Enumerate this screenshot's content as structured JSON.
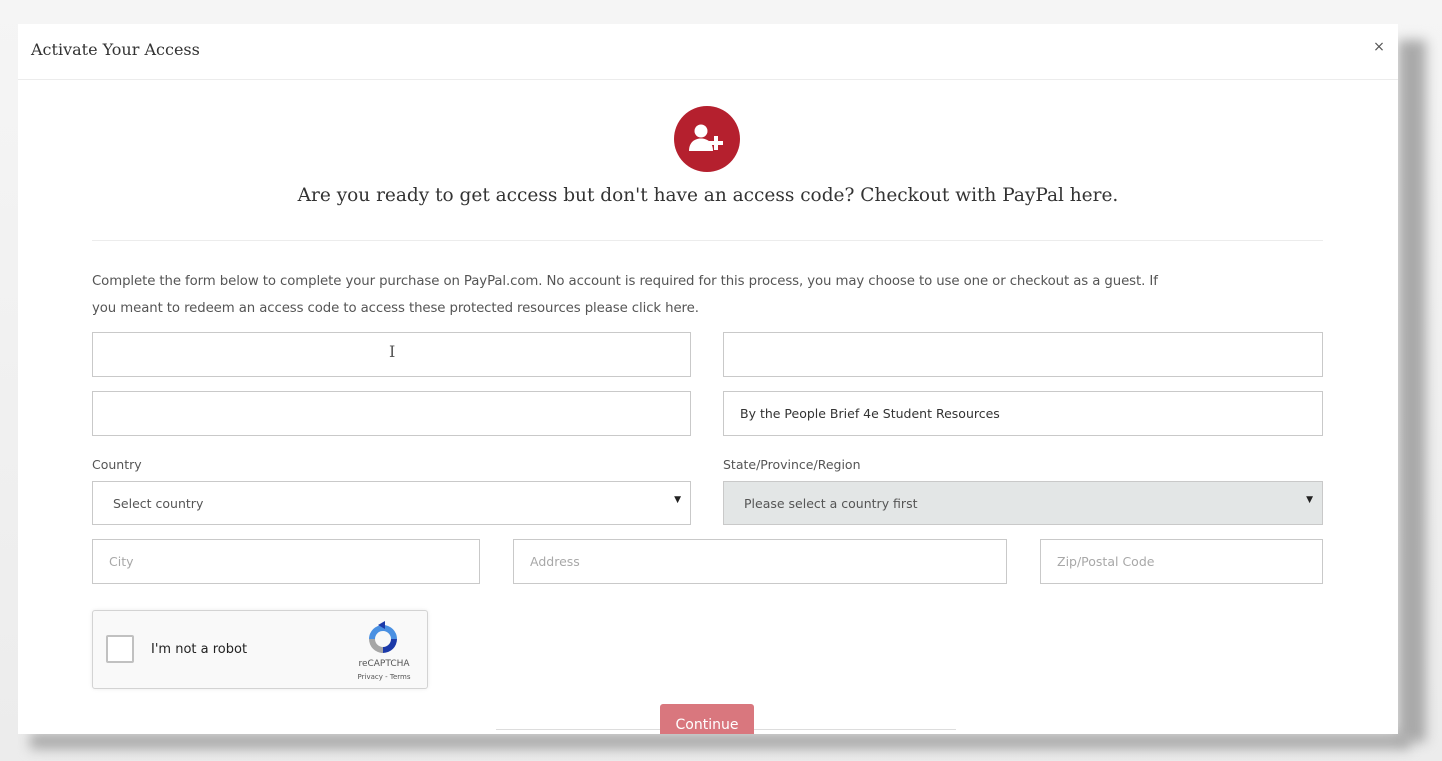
{
  "modal": {
    "title": "Activate Your Access",
    "close_label": "×",
    "icon": "user-plus-icon",
    "accent_color": "#b5202e",
    "headline": "Are you ready to get access but don't have an access code? Checkout with PayPal here.",
    "intro_line1": "Complete the form below to complete your purchase on PayPal.com. No account is required for this process, you may choose to use one or checkout as a guest. If",
    "intro_line2": "you meant to redeem an access code to access these protected resources please click here."
  },
  "form": {
    "product_value": "By the People Brief 4e Student Resources",
    "country_label": "Country",
    "country_selected": "Select country",
    "state_label": "State/Province/Region",
    "state_selected": "Please select a country first",
    "city_placeholder": "City",
    "address_placeholder": "Address",
    "zip_placeholder": "Zip/Postal Code",
    "continue_label": "Continue",
    "continue_color": "#d9777e"
  },
  "recaptcha": {
    "label": "I'm not a robot",
    "brand": "reCAPTCHA",
    "links": "Privacy - Terms"
  }
}
